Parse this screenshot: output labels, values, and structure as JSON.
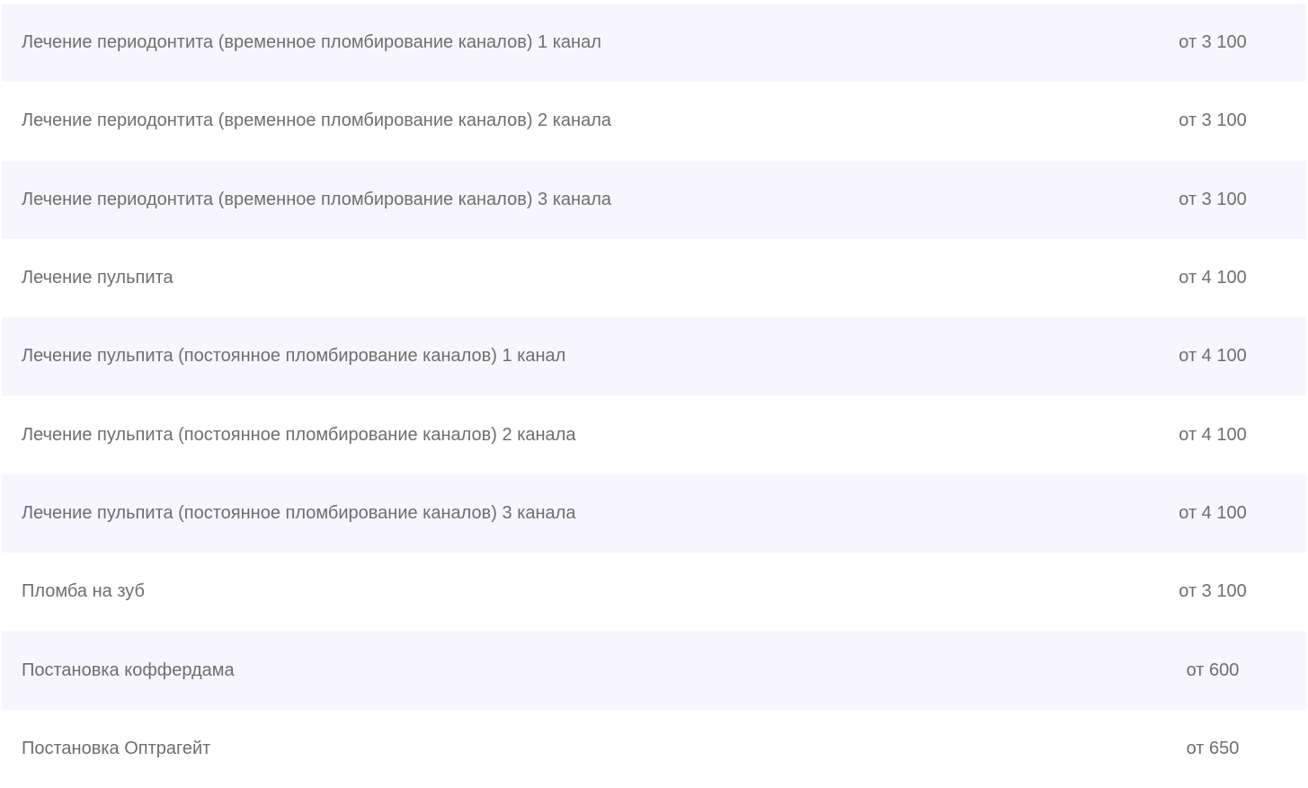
{
  "price_list": {
    "rows": [
      {
        "name": "Лечение периодонтита (временное пломбирование каналов) 1 канал",
        "price": "от 3 100"
      },
      {
        "name": "Лечение периодонтита (временное пломбирование каналов) 2 канала",
        "price": "от 3 100"
      },
      {
        "name": "Лечение периодонтита (временное пломбирование каналов) 3 канала",
        "price": "от 3 100"
      },
      {
        "name": "Лечение пульпита",
        "price": "от 4 100"
      },
      {
        "name": "Лечение пульпита (постоянное пломбирование каналов) 1 канал",
        "price": "от 4 100"
      },
      {
        "name": "Лечение пульпита (постоянное пломбирование каналов) 2 канала",
        "price": "от 4 100"
      },
      {
        "name": "Лечение пульпита (постоянное пломбирование каналов) 3 канала",
        "price": "от 4 100"
      },
      {
        "name": "Пломба на зуб",
        "price": "от 3 100"
      },
      {
        "name": "Постановка коффердама",
        "price": "от 600"
      },
      {
        "name": "Постановка Оптрагейт",
        "price": "от 650"
      }
    ]
  },
  "colors": {
    "row_alt_background": "#f7f6fe",
    "row_background": "#ffffff",
    "text": "#6e6e6e"
  }
}
